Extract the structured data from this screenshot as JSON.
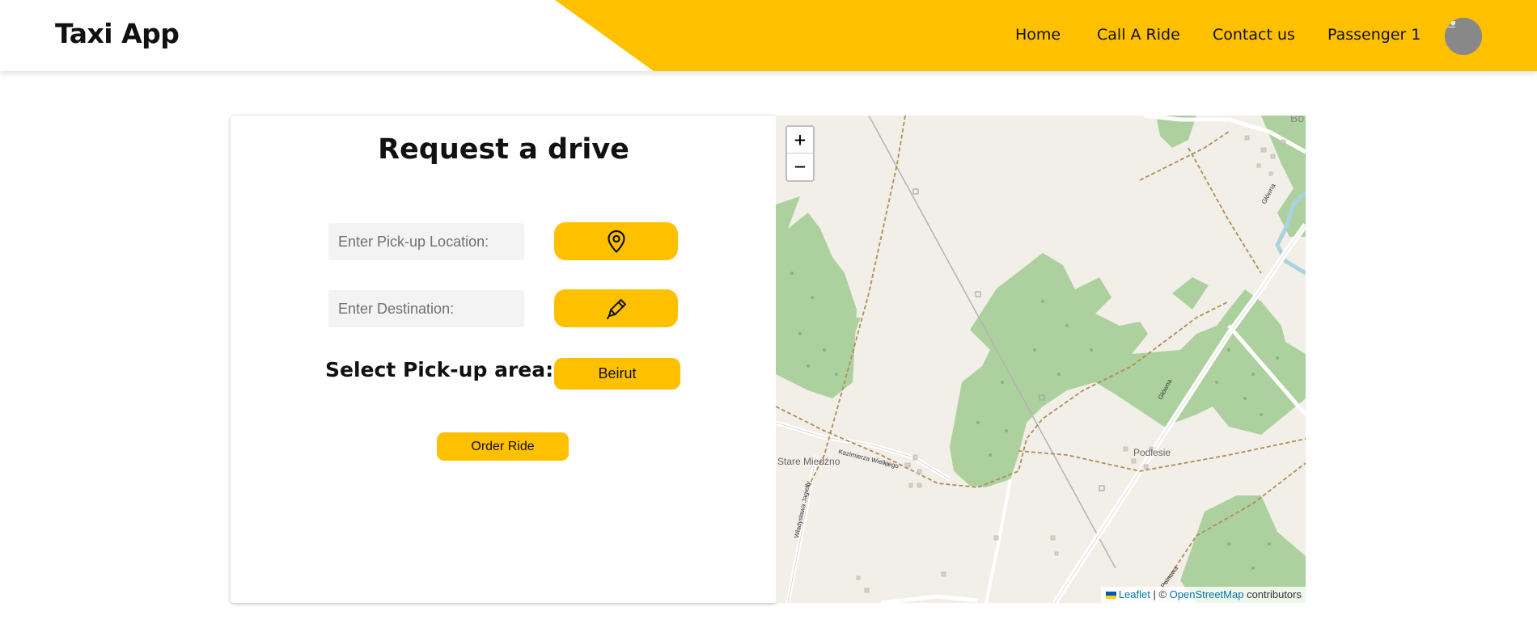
{
  "header": {
    "brand": "Taxi App",
    "nav": [
      {
        "label": "Home"
      },
      {
        "label": "Call A Ride"
      },
      {
        "label": "Contact us"
      },
      {
        "label": "Passenger 1"
      }
    ],
    "accent_color": "#ffc000"
  },
  "form": {
    "title": "Request a drive",
    "pickup_placeholder": "Enter Pick-up Location:",
    "pickup_value": "",
    "pickup_button_icon": "map-pin-icon",
    "destination_placeholder": "Enter Destination:",
    "destination_value": "",
    "destination_button_icon": "pencil-icon",
    "area_label": "Select Pick-up area:",
    "area_selected": "Beirut",
    "order_label": "Order Ride"
  },
  "map": {
    "zoom_in": "+",
    "zoom_out": "−",
    "labels": {
      "place_stare": "Stare Miedźno",
      "place_podlesie": "Podlesie",
      "place_bo": "Bo",
      "street_kazimierza": "Kazimierza Wielkiego",
      "street_glowna_1": "Główna",
      "street_glowna_2": "Główna",
      "street_wladyslawa": "Władysława Jagiełły",
      "street_polnawa": "Polnawa"
    },
    "attribution": {
      "leaflet": "Leaflet",
      "separator": " | © ",
      "osm": "OpenStreetMap",
      "suffix": " contributors"
    }
  }
}
